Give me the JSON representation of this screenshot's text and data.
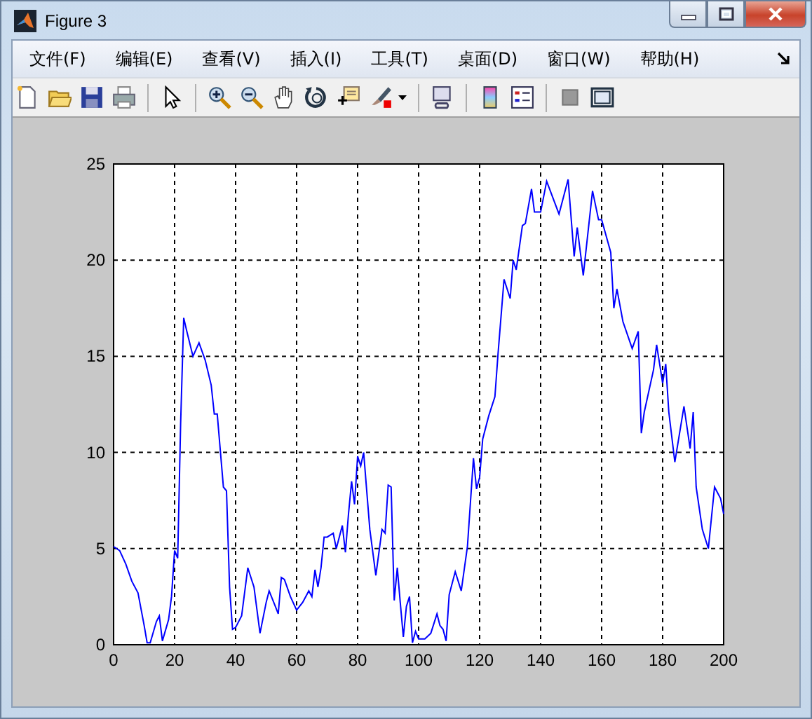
{
  "window": {
    "title": "Figure 3"
  },
  "menu": [
    {
      "label": "文件(F)"
    },
    {
      "label": "编辑(E)"
    },
    {
      "label": "查看(V)"
    },
    {
      "label": "插入(I)"
    },
    {
      "label": "工具(T)"
    },
    {
      "label": "桌面(D)"
    },
    {
      "label": "窗口(W)"
    },
    {
      "label": "帮助(H)"
    }
  ],
  "figure": {
    "chart_data": {
      "type": "line",
      "grid": true,
      "xlim": [
        0,
        200
      ],
      "ylim": [
        0,
        25
      ],
      "xticks": [
        0,
        20,
        40,
        60,
        80,
        100,
        120,
        140,
        160,
        180,
        200
      ],
      "yticks": [
        0,
        5,
        10,
        15,
        20,
        25
      ],
      "x": [
        0,
        2,
        4,
        6,
        8,
        10,
        11,
        12,
        14,
        15,
        16,
        18,
        19,
        20,
        21,
        22,
        23,
        24,
        26,
        28,
        30,
        32,
        33,
        34,
        36,
        37,
        38,
        39,
        40,
        42,
        44,
        46,
        48,
        50,
        51,
        53,
        54,
        55,
        56,
        58,
        60,
        62,
        64,
        65,
        66,
        67,
        68,
        69,
        70,
        72,
        73,
        75,
        76,
        77,
        78,
        79,
        80,
        81,
        82,
        84,
        86,
        88,
        89,
        90,
        91,
        92,
        93,
        94,
        95,
        96,
        97,
        98,
        99,
        100,
        102,
        104,
        106,
        107,
        108,
        109,
        110,
        112,
        114,
        116,
        118,
        119,
        120,
        121,
        123,
        125,
        126,
        128,
        130,
        131,
        132,
        134,
        135,
        137,
        138,
        140,
        142,
        146,
        149,
        151,
        152,
        154,
        157,
        159,
        160,
        163,
        164,
        165,
        167,
        170,
        172,
        173,
        174,
        177,
        178,
        180,
        181,
        182,
        184,
        187,
        189,
        190,
        191,
        193,
        195,
        197,
        199,
        200
      ],
      "series": [
        {
          "color": "#0000ff",
          "values": [
            5.1,
            4.9,
            4.2,
            3.3,
            2.7,
            1.0,
            0.1,
            0.1,
            1.2,
            1.5,
            0.2,
            1.3,
            2.5,
            4.9,
            4.5,
            11.5,
            17,
            16.3,
            15,
            15.7,
            14.8,
            13.5,
            12,
            12,
            8.2,
            8,
            3,
            0.8,
            0.9,
            1.5,
            4,
            3,
            0.6,
            2.2,
            2.8,
            2,
            1.6,
            3.5,
            3.4,
            2.5,
            1.8,
            2.2,
            2.8,
            2.5,
            3.9,
            3,
            4,
            5.6,
            5.6,
            5.8,
            5,
            6.2,
            4.8,
            6.8,
            8.5,
            7.3,
            9.8,
            9.3,
            10,
            6,
            3.6,
            6,
            5.8,
            8.3,
            8.2,
            2.3,
            4,
            2.2,
            0.4,
            2,
            2.5,
            0.1,
            0.7,
            0.3,
            0.3,
            0.6,
            1.6,
            1,
            0.8,
            0.2,
            2.6,
            3.8,
            2.8,
            5.1,
            9.7,
            8.1,
            8.7,
            10.7,
            11.9,
            12.9,
            15.1,
            19,
            18,
            20,
            19.5,
            21.8,
            21.9,
            23.7,
            22.5,
            22.5,
            24.1,
            22.4,
            24.2,
            20.2,
            21.7,
            19.2,
            23.6,
            22.1,
            22.1,
            20.4,
            17.5,
            18.5,
            16.8,
            15.4,
            16.3,
            11,
            12.1,
            14.3,
            15.6,
            13.6,
            14.6,
            12.1,
            9.5,
            12.4,
            10.2,
            12.1,
            8.2,
            6,
            5,
            8.2,
            7.6,
            6.8
          ]
        }
      ]
    }
  }
}
